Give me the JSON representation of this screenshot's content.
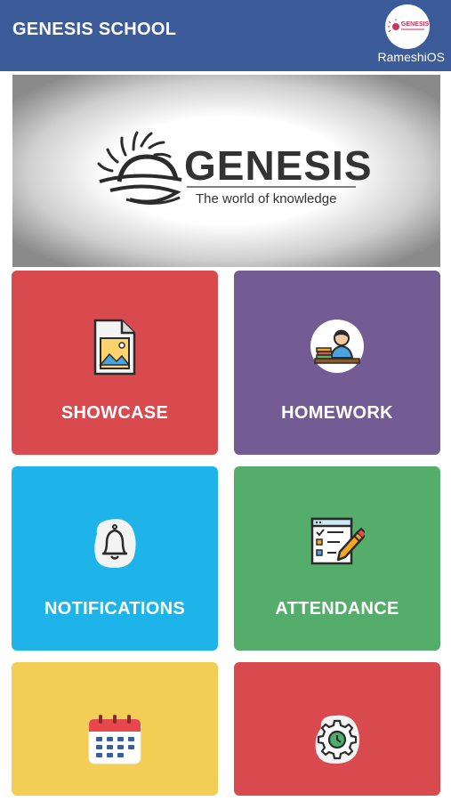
{
  "header": {
    "title": "GENESIS SCHOOL",
    "username": "RameshiOS",
    "avatar_logo_text": "GENESIS"
  },
  "banner": {
    "brand": "GENESIS",
    "tagline": "The world of knowledge"
  },
  "tiles": [
    {
      "label": "SHOWCASE",
      "color": "#d84a4e",
      "icon": "image-document-icon"
    },
    {
      "label": "HOMEWORK",
      "color": "#735c93",
      "icon": "student-reading-icon"
    },
    {
      "label": "NOTIFICATIONS",
      "color": "#1eb4ea",
      "icon": "bell-icon"
    },
    {
      "label": "ATTENDANCE",
      "color": "#55ad6c",
      "icon": "checklist-pencil-icon"
    },
    {
      "label": "",
      "color": "#f3ce55",
      "icon": "calendar-icon"
    },
    {
      "label": "",
      "color": "#d84a4e",
      "icon": "gear-clock-icon"
    }
  ]
}
